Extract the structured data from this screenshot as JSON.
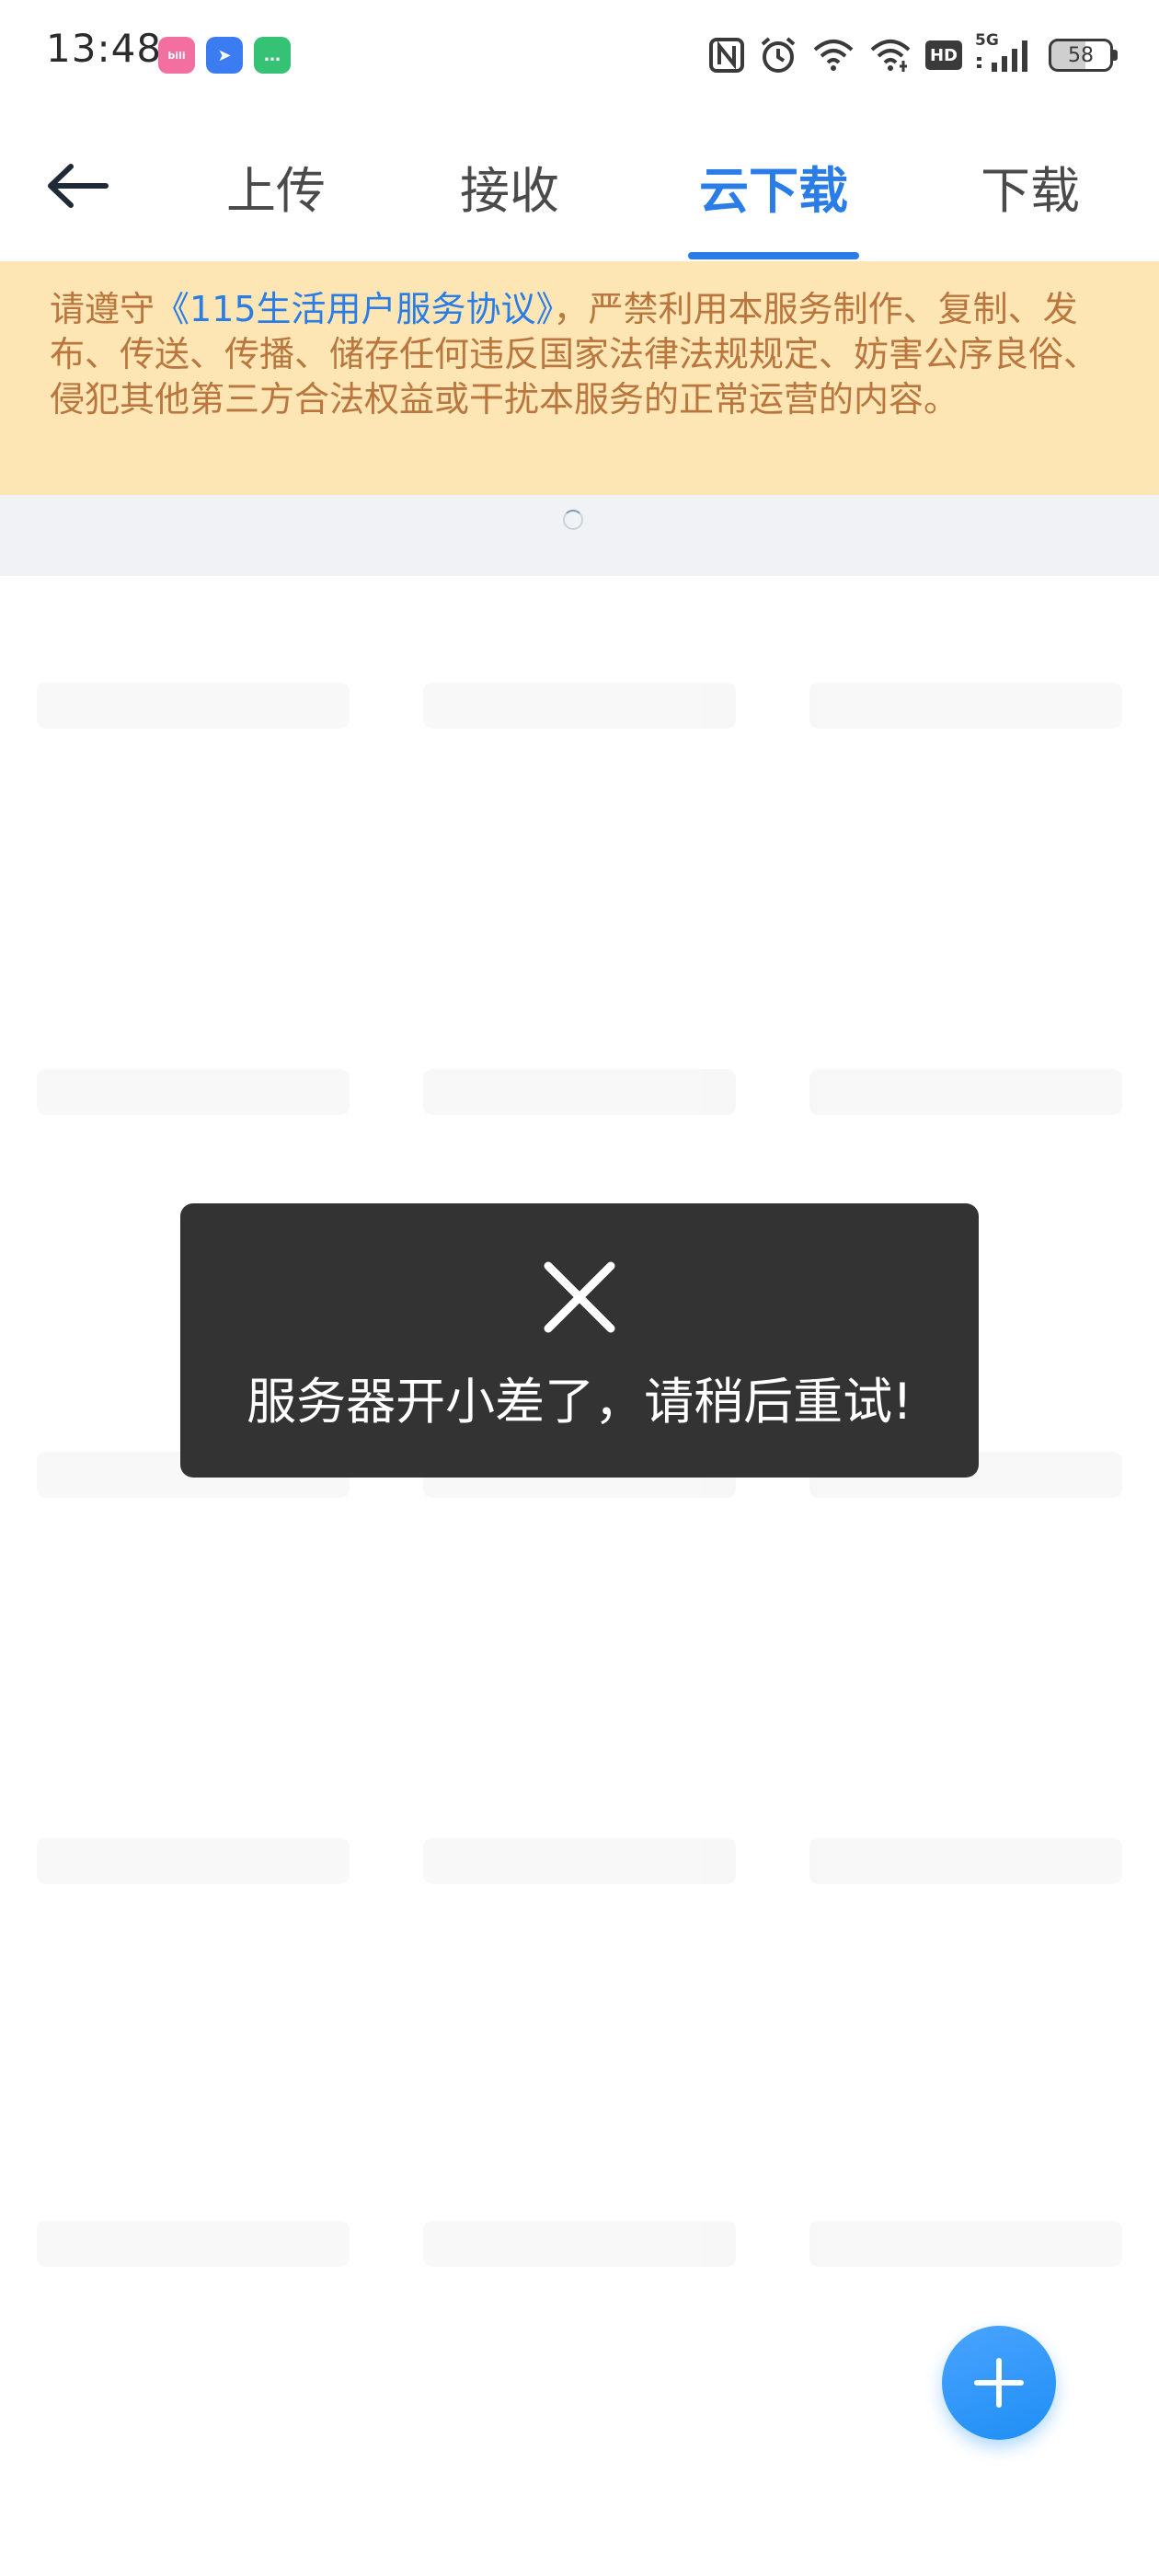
{
  "status_bar": {
    "time": "13:48",
    "notification_icons": [
      {
        "name": "bilibili-icon",
        "color": "#f36fa0",
        "glyph": "bili"
      },
      {
        "name": "direction-app-icon",
        "color": "#3b7cf2",
        "glyph": "➤"
      },
      {
        "name": "message-app-icon",
        "color": "#35c274",
        "glyph": "…"
      }
    ],
    "network_label": "5G",
    "hd_label": "HD",
    "battery_level": "58"
  },
  "header": {
    "back_icon": "back-arrow-icon",
    "tabs": [
      {
        "label": "上传",
        "active": false
      },
      {
        "label": "接收",
        "active": false
      },
      {
        "label": "云下载",
        "active": true
      },
      {
        "label": "下载",
        "active": false
      }
    ]
  },
  "notice": {
    "prefix": "请遵守",
    "link_text": "《115生活用户服务协议》",
    "suffix": "，严禁利用本服务制作、复制、发布、传送、传播、储存任何违反国家法律法规规定、妨害公序良俗、侵犯其他第三方合法权益或干扰本服务的正常运营的内容。"
  },
  "toast": {
    "icon": "close-icon",
    "message": "服务器开小差了，请稍后重试!"
  },
  "fab": {
    "icon": "plus-icon"
  },
  "colors": {
    "accent": "#2a7de6",
    "notice_bg": "#fde6b3",
    "notice_text": "#b9763e",
    "toast_bg": "#333333",
    "fab": "#1e8ef5"
  }
}
